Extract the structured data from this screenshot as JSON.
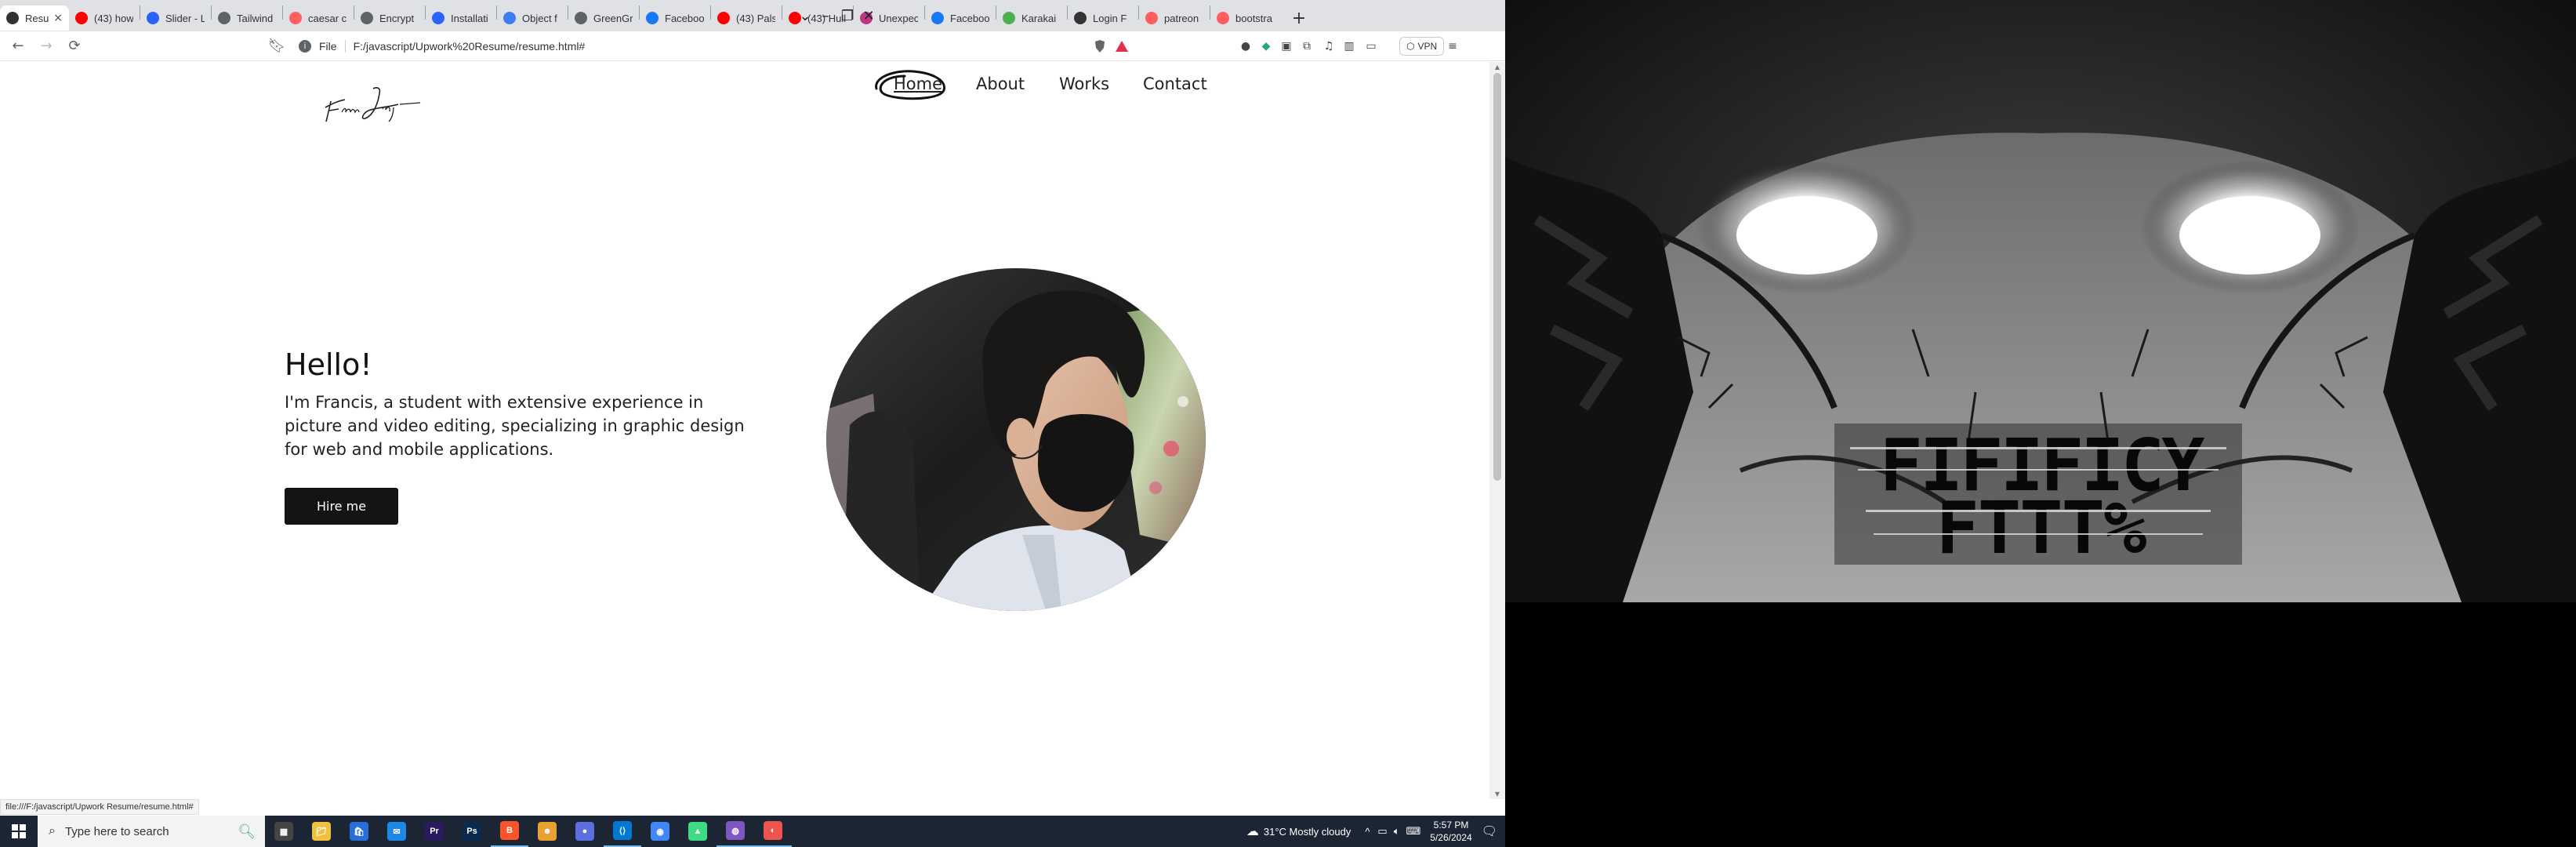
{
  "browser": {
    "tabs": [
      {
        "label": "Resu",
        "color": "#333333",
        "active": true
      },
      {
        "label": "(43) how",
        "color": "#ff0000"
      },
      {
        "label": "Slider - L",
        "color": "#2962ff"
      },
      {
        "label": "Tailwind",
        "color": "#5f6368"
      },
      {
        "label": "caesar ci",
        "color": "#ff5e5e"
      },
      {
        "label": "Encrypt",
        "color": "#5f6368"
      },
      {
        "label": "Installati",
        "color": "#2962ff"
      },
      {
        "label": "Object f",
        "color": "#3d7ef5"
      },
      {
        "label": "GreenGr",
        "color": "#5f6368"
      },
      {
        "label": "Facebook",
        "color": "#1877f2"
      },
      {
        "label": "(43) Pals",
        "color": "#ff0000"
      },
      {
        "label": "(43) Hull",
        "color": "#ff0000"
      },
      {
        "label": "Unexpec",
        "color": "#c13584"
      },
      {
        "label": "Facebook",
        "color": "#1877f2"
      },
      {
        "label": "Karakai",
        "color": "#4caf50"
      },
      {
        "label": "Login F",
        "color": "#333333"
      },
      {
        "label": "patreon",
        "color": "#ff5e5e"
      },
      {
        "label": "bootstra",
        "color": "#ff5e5e"
      }
    ],
    "address_prefix": "File",
    "url": "F:/javascript/Upwork%20Resume/resume.html#",
    "vpn_label": "VPN",
    "status_url": "file:///F:/javascript/Upwork Resume/resume.html#"
  },
  "site": {
    "logo_text": "Francis Jay",
    "nav": {
      "home": "Home",
      "about": "About",
      "works": "Works",
      "contact": "Contact"
    },
    "hero": {
      "greeting": "Hello!",
      "intro": "I'm Francis, a student with extensive experience in picture and video editing, specializing in graphic design for web and mobile applications.",
      "cta": "Hire me"
    }
  },
  "taskbar": {
    "search_placeholder": "Type here to search",
    "weather": "31°C  Mostly cloudy",
    "time": "5:57 PM",
    "date": "5/26/2024",
    "apps": [
      "Task View",
      "File Explorer",
      "Microsoft Store",
      "Mail",
      "Premiere Pro",
      "Photoshop",
      "Brave",
      "Game",
      "Brave Beta",
      "VS Code",
      "Chrome",
      "Android Studio",
      "Browser",
      "Browser Nightly"
    ]
  },
  "wallpaper": {
    "glitch_text": "FIFIFICY FTTT%"
  }
}
